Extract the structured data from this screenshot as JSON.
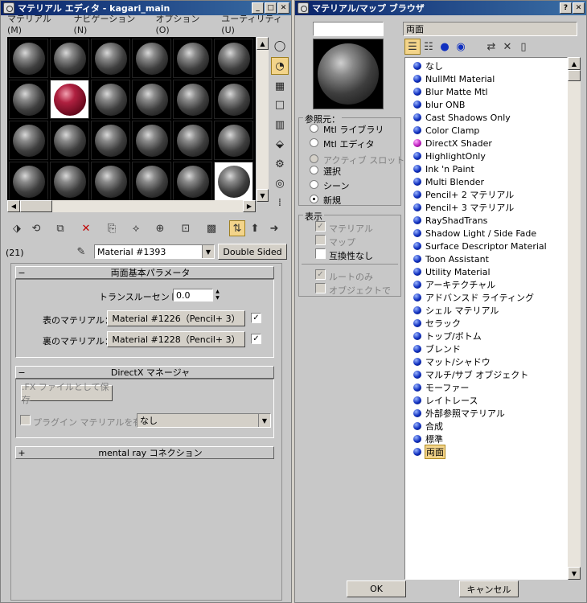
{
  "editor": {
    "title": "マテリアル エディタ - kagari_main",
    "menu": [
      "マテリアル(M)",
      "ナビゲーション(N)",
      "オプション(O)",
      "ユーティリティ(U)"
    ],
    "count": "(21)",
    "material_name": "Material #1393",
    "type_button": "Double Sided",
    "rollout_double": {
      "title": "両面基本パラメータ",
      "translucency_label": "トランスルーセント：",
      "translucency_value": "0.0",
      "front_label": "表のマテリアル：",
      "front_value": "Material #1226（Pencil+ 3）",
      "back_label": "裏のマテリアル：",
      "back_value": "Material #1228（Pencil+ 3）"
    },
    "rollout_directx": {
      "title": "DirectX マネージャ",
      "save_fx": ".FX ファイルとして保存",
      "plugin_label": "プラグイン マテリアルを有効",
      "plugin_value": "なし"
    },
    "rollout_mental": {
      "title": "mental ray コネクション"
    }
  },
  "browser": {
    "title": "マテリアル/マップ ブラウザ",
    "name_field": "",
    "name_label": "両面",
    "browse_from": {
      "title": "参照元：",
      "options": [
        "Mtl ライブラリ",
        "Mtl エディタ",
        "アクティブ スロット",
        "選択",
        "シーン",
        "新規"
      ],
      "selected": "新規"
    },
    "show": {
      "title": "表示",
      "material": "マテリアル",
      "map": "マップ",
      "incompatible": "互換性なし",
      "root_only": "ルートのみ",
      "by_object": "オブジェクトで"
    },
    "items": [
      "なし",
      "NullMtl Material",
      "Blur Matte Mtl",
      "blur ONB",
      "Cast Shadows Only",
      "Color Clamp",
      "DirectX Shader",
      "HighlightOnly",
      "Ink 'n Paint",
      "Multi Blender",
      "Pencil+ 2 マテリアル",
      "Pencil+ 3 マテリアル",
      "RayShadTrans",
      "Shadow Light / Side Fade",
      "Surface Descriptor Material",
      "Toon Assistant",
      "Utility Material",
      "アーキテクチャル",
      "アドバンスド ライティング",
      "シェル マテリアル",
      "セラック",
      "トップ/ボトム",
      "ブレンド",
      "マット/シャドウ",
      "マルチ/サブ オブジェクト",
      "モーファー",
      "レイトレース",
      "外部参照マテリアル",
      "合成",
      "標準",
      "両面"
    ],
    "selected_item": "両面",
    "ok": "OK",
    "cancel": "キャンセル"
  },
  "colors": {
    "accent": "#f3d48a",
    "title_start": "#0a246a",
    "title_end": "#3a6ea5"
  }
}
